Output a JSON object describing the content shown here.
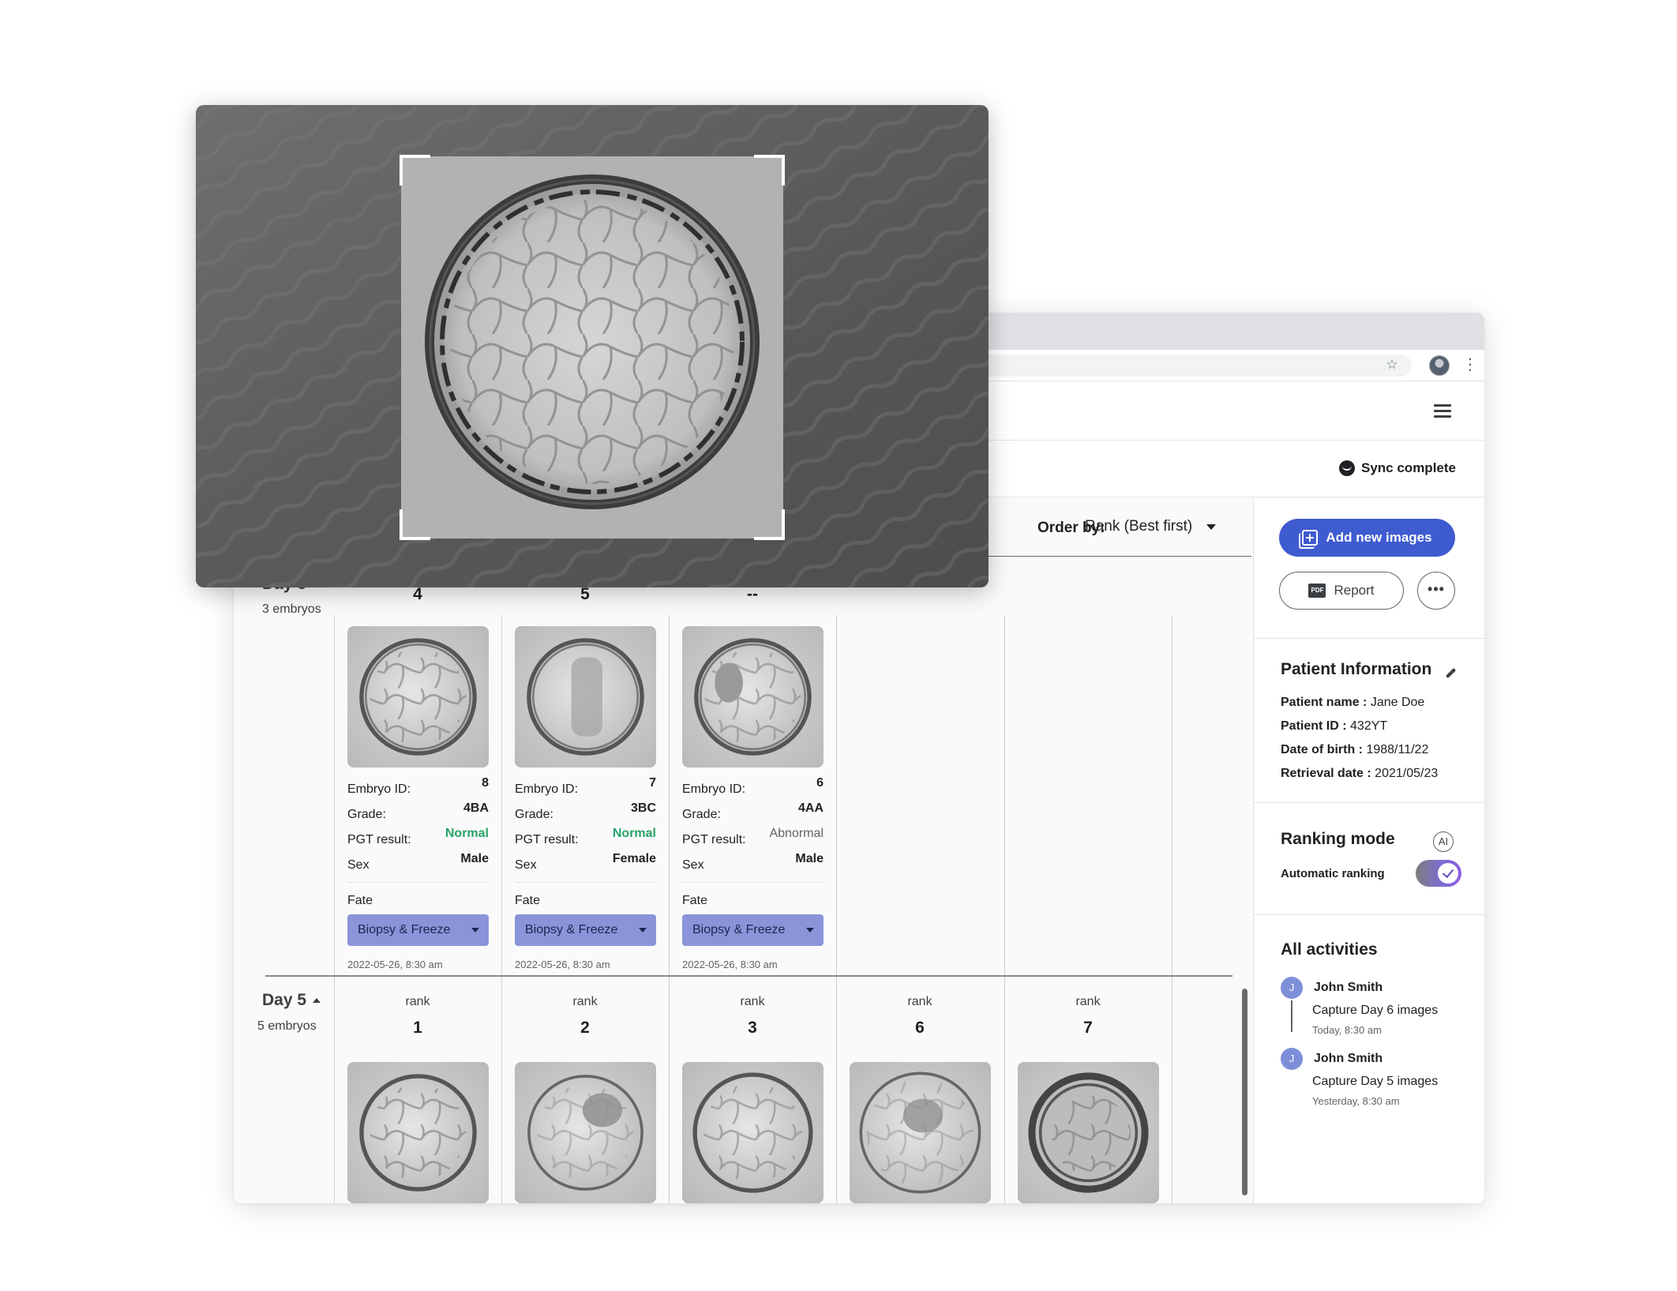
{
  "browser": {
    "star_icon": "star-icon",
    "profile_icon": "profile-avatar",
    "menu_icon": "kebab-icon"
  },
  "app": {
    "menu_icon": "hamburger-icon",
    "sync": {
      "label": "Sync complete",
      "icon": "sync-icon"
    }
  },
  "order": {
    "label": "Order by:",
    "value": "Rank (Best first)"
  },
  "day6": {
    "title": "Day 6",
    "count": "3 embryos",
    "columns": [
      {
        "rank": "4",
        "embryo_id_label": "Embryo ID:",
        "embryo_id": "8",
        "grade_label": "Grade:",
        "grade": "4BA",
        "pgt_label": "PGT result:",
        "pgt": "Normal",
        "sex_label": "Sex",
        "sex": "Male",
        "fate_label": "Fate",
        "fate": "Biopsy & Freeze",
        "date": "2022-05-26, 8:30 am"
      },
      {
        "rank": "5",
        "embryo_id_label": "Embryo ID:",
        "embryo_id": "7",
        "grade_label": "Grade:",
        "grade": "3BC",
        "pgt_label": "PGT result:",
        "pgt": "Normal",
        "sex_label": "Sex",
        "sex": "Female",
        "fate_label": "Fate",
        "fate": "Biopsy & Freeze",
        "date": "2022-05-26, 8:30 am"
      },
      {
        "rank": "--",
        "embryo_id_label": "Embryo ID:",
        "embryo_id": "6",
        "grade_label": "Grade:",
        "grade": "4AA",
        "pgt_label": "PGT result:",
        "pgt": "Abnormal",
        "sex_label": "Sex",
        "sex": "Male",
        "fate_label": "Fate",
        "fate": "Biopsy & Freeze",
        "date": "2022-05-26, 8:30 am"
      }
    ]
  },
  "day5": {
    "title": "Day 5",
    "count": "5 embryos",
    "columns": [
      {
        "rank_label": "rank",
        "rank": "1"
      },
      {
        "rank_label": "rank",
        "rank": "2"
      },
      {
        "rank_label": "rank",
        "rank": "3"
      },
      {
        "rank_label": "rank",
        "rank": "6"
      },
      {
        "rank_label": "rank",
        "rank": "7"
      }
    ]
  },
  "panel": {
    "add_images": "Add new images",
    "report": "Report",
    "more": "•••",
    "patient": {
      "title": "Patient Information",
      "name_label": "Patient name :",
      "name": "Jane Doe",
      "id_label": "Patient ID :",
      "id": "432YT",
      "dob_label": "Date of birth :",
      "dob": "1988/11/22",
      "retrieval_label": "Retrieval date :",
      "retrieval": "2021/05/23"
    },
    "ranking": {
      "title": "Ranking mode",
      "ai_badge": "AI",
      "auto_label": "Automatic ranking",
      "auto_enabled": true
    },
    "activities": {
      "title": "All activities",
      "items": [
        {
          "initial": "J",
          "name": "John Smith",
          "text": "Capture Day 6 images",
          "time": "Today, 8:30 am"
        },
        {
          "initial": "J",
          "name": "John Smith",
          "text": "Capture Day 5 images",
          "time": "Yesterday, 8:30 am"
        }
      ]
    }
  },
  "colors": {
    "primary": "#3f5bd0",
    "fate_select": "#8b94d9",
    "pgt_normal": "#29a36a",
    "avatar": "#7d8fd8"
  }
}
